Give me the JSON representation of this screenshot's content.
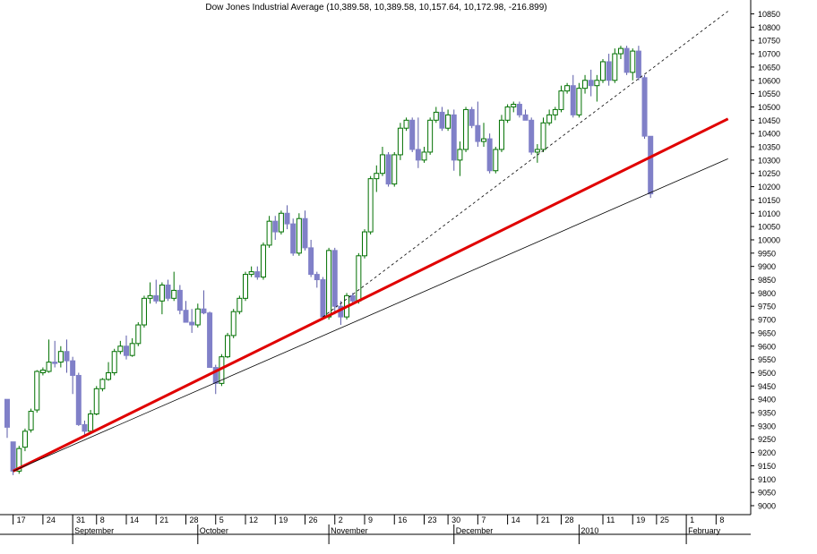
{
  "chart_data": {
    "type": "candlestick",
    "title": "Dow Jones Industrial Average (10,389.58, 10,389.58, 10,157.64, 10,172.98, -216.899)",
    "ylim": [
      8950,
      10900
    ],
    "y_ticks": [
      9000,
      9050,
      9100,
      9150,
      9200,
      9250,
      9300,
      9350,
      9400,
      9450,
      9500,
      9550,
      9600,
      9650,
      9700,
      9750,
      9800,
      9850,
      9900,
      9950,
      10000,
      10050,
      10100,
      10150,
      10200,
      10250,
      10300,
      10350,
      10400,
      10450,
      10500,
      10550,
      10600,
      10650,
      10700,
      10750,
      10800,
      10850
    ],
    "x_day_ticks": [
      {
        "i": 1,
        "label": "17"
      },
      {
        "i": 6,
        "label": "24"
      },
      {
        "i": 11,
        "label": "31"
      },
      {
        "i": 15,
        "label": "8"
      },
      {
        "i": 20,
        "label": "14"
      },
      {
        "i": 25,
        "label": "21"
      },
      {
        "i": 30,
        "label": "28"
      },
      {
        "i": 35,
        "label": "5"
      },
      {
        "i": 40,
        "label": "12"
      },
      {
        "i": 45,
        "label": "19"
      },
      {
        "i": 50,
        "label": "26"
      },
      {
        "i": 55,
        "label": "2"
      },
      {
        "i": 60,
        "label": "9"
      },
      {
        "i": 65,
        "label": "16"
      },
      {
        "i": 70,
        "label": "23"
      },
      {
        "i": 74,
        "label": "30"
      },
      {
        "i": 79,
        "label": "7"
      },
      {
        "i": 84,
        "label": "14"
      },
      {
        "i": 89,
        "label": "21"
      },
      {
        "i": 93,
        "label": "28"
      },
      {
        "i": 100,
        "label": "11"
      },
      {
        "i": 105,
        "label": "19"
      },
      {
        "i": 109,
        "label": "25"
      },
      {
        "i": 114,
        "label": "1"
      },
      {
        "i": 119,
        "label": "8"
      }
    ],
    "x_month_ticks": [
      {
        "i": 11,
        "label": "September"
      },
      {
        "i": 32,
        "label": "October"
      },
      {
        "i": 54,
        "label": "November"
      },
      {
        "i": 75,
        "label": "December"
      },
      {
        "i": 96,
        "label": "2010"
      },
      {
        "i": 114,
        "label": "February"
      }
    ],
    "series": [
      {
        "ohlc": [
          [
            9400,
            9400,
            9255,
            9295
          ],
          [
            9240,
            9240,
            9115,
            9130
          ],
          [
            9130,
            9225,
            9120,
            9215
          ],
          [
            9220,
            9290,
            9205,
            9280
          ],
          [
            9285,
            9365,
            9275,
            9355
          ],
          [
            9360,
            9510,
            9350,
            9505
          ],
          [
            9500,
            9520,
            9490,
            9510
          ],
          [
            9505,
            9625,
            9500,
            9540
          ],
          [
            9540,
            9620,
            9520,
            9535
          ],
          [
            9540,
            9600,
            9520,
            9580
          ],
          [
            9580,
            9625,
            9500,
            9545
          ],
          [
            9545,
            9560,
            9420,
            9490
          ],
          [
            9490,
            9500,
            9300,
            9305
          ],
          [
            9305,
            9320,
            9260,
            9280
          ],
          [
            9280,
            9360,
            9270,
            9345
          ],
          [
            9345,
            9450,
            9340,
            9440
          ],
          [
            9440,
            9480,
            9430,
            9475
          ],
          [
            9475,
            9540,
            9470,
            9500
          ],
          [
            9500,
            9590,
            9490,
            9580
          ],
          [
            9580,
            9620,
            9570,
            9600
          ],
          [
            9600,
            9640,
            9550,
            9565
          ],
          [
            9565,
            9630,
            9560,
            9610
          ],
          [
            9610,
            9690,
            9600,
            9680
          ],
          [
            9680,
            9790,
            9670,
            9780
          ],
          [
            9780,
            9840,
            9760,
            9790
          ],
          [
            9790,
            9850,
            9760,
            9770
          ],
          [
            9770,
            9840,
            9720,
            9830
          ],
          [
            9830,
            9850,
            9770,
            9780
          ],
          [
            9780,
            9880,
            9770,
            9810
          ],
          [
            9810,
            9830,
            9720,
            9735
          ],
          [
            9735,
            9770,
            9690,
            9690
          ],
          [
            9690,
            9740,
            9650,
            9680
          ],
          [
            9680,
            9760,
            9670,
            9740
          ],
          [
            9740,
            9810,
            9720,
            9725
          ],
          [
            9725,
            9730,
            9520,
            9520
          ],
          [
            9520,
            9530,
            9420,
            9460
          ],
          [
            9460,
            9570,
            9450,
            9560
          ],
          [
            9560,
            9650,
            9555,
            9640
          ],
          [
            9640,
            9740,
            9630,
            9730
          ],
          [
            9730,
            9790,
            9720,
            9780
          ],
          [
            9780,
            9880,
            9770,
            9870
          ],
          [
            9870,
            9900,
            9860,
            9880
          ],
          [
            9880,
            9900,
            9850,
            9860
          ],
          [
            9860,
            9990,
            9850,
            9980
          ],
          [
            9980,
            10090,
            9970,
            10070
          ],
          [
            10070,
            10090,
            10000,
            10030
          ],
          [
            10030,
            10110,
            10020,
            10100
          ],
          [
            10100,
            10130,
            10040,
            10060
          ],
          [
            10060,
            10080,
            9940,
            9950
          ],
          [
            9950,
            10100,
            9940,
            10080
          ],
          [
            10080,
            10110,
            9960,
            9970
          ],
          [
            9970,
            10000,
            9860,
            9870
          ],
          [
            9870,
            9880,
            9820,
            9850
          ],
          [
            9850,
            9860,
            9700,
            9710
          ],
          [
            9710,
            9970,
            9700,
            9960
          ],
          [
            9960,
            9970,
            9720,
            9750
          ],
          [
            9750,
            9770,
            9680,
            9710
          ],
          [
            9710,
            9800,
            9700,
            9790
          ],
          [
            9790,
            9800,
            9760,
            9770
          ],
          [
            9770,
            9950,
            9760,
            9940
          ],
          [
            9940,
            10040,
            9930,
            10030
          ],
          [
            10030,
            10240,
            10020,
            10230
          ],
          [
            10230,
            10280,
            10180,
            10250
          ],
          [
            10250,
            10350,
            10240,
            10320
          ],
          [
            10320,
            10330,
            10200,
            10210
          ],
          [
            10210,
            10330,
            10200,
            10320
          ],
          [
            10320,
            10440,
            10300,
            10420
          ],
          [
            10420,
            10460,
            10410,
            10450
          ],
          [
            10450,
            10460,
            10330,
            10340
          ],
          [
            10340,
            10460,
            10270,
            10300
          ],
          [
            10300,
            10350,
            10290,
            10330
          ],
          [
            10330,
            10460,
            10320,
            10450
          ],
          [
            10450,
            10500,
            10440,
            10480
          ],
          [
            10480,
            10500,
            10410,
            10420
          ],
          [
            10420,
            10490,
            10410,
            10470
          ],
          [
            10470,
            10490,
            10260,
            10300
          ],
          [
            10300,
            10370,
            10240,
            10340
          ],
          [
            10340,
            10500,
            10330,
            10490
          ],
          [
            10490,
            10500,
            10420,
            10430
          ],
          [
            10430,
            10520,
            10350,
            10370
          ],
          [
            10370,
            10440,
            10350,
            10380
          ],
          [
            10380,
            10400,
            10250,
            10260
          ],
          [
            10260,
            10350,
            10250,
            10340
          ],
          [
            10340,
            10470,
            10330,
            10450
          ],
          [
            10450,
            10510,
            10440,
            10500
          ],
          [
            10500,
            10520,
            10480,
            10510
          ],
          [
            10510,
            10520,
            10460,
            10470
          ],
          [
            10470,
            10490,
            10450,
            10450
          ],
          [
            10450,
            10460,
            10320,
            10330
          ],
          [
            10330,
            10360,
            10290,
            10340
          ],
          [
            10340,
            10460,
            10330,
            10440
          ],
          [
            10440,
            10490,
            10430,
            10470
          ],
          [
            10470,
            10500,
            10450,
            10490
          ],
          [
            10490,
            10580,
            10480,
            10560
          ],
          [
            10560,
            10590,
            10550,
            10580
          ],
          [
            10580,
            10620,
            10460,
            10470
          ],
          [
            10470,
            10590,
            10460,
            10570
          ],
          [
            10570,
            10620,
            10550,
            10600
          ],
          [
            10600,
            10640,
            10540,
            10580
          ],
          [
            10580,
            10620,
            10520,
            10600
          ],
          [
            10600,
            10680,
            10590,
            10670
          ],
          [
            10670,
            10700,
            10580,
            10600
          ],
          [
            10600,
            10720,
            10590,
            10700
          ],
          [
            10700,
            10730,
            10680,
            10720
          ],
          [
            10720,
            10730,
            10620,
            10630
          ],
          [
            10630,
            10720,
            10600,
            10710
          ],
          [
            10710,
            10730,
            10600,
            10610
          ],
          [
            10610,
            10620,
            10380,
            10390
          ],
          [
            10389.58,
            10389.58,
            10157.64,
            10172.98
          ]
        ]
      }
    ],
    "annotations": [
      {
        "type": "trendline",
        "color": "#e00000",
        "style": "solid",
        "from": [
          1,
          9130
        ],
        "to": [
          121,
          10455
        ]
      },
      {
        "type": "trendline",
        "color": "#000000",
        "style": "solid",
        "from": [
          1,
          9130
        ],
        "to": [
          121,
          10305
        ]
      },
      {
        "type": "trendline",
        "color": "#000000",
        "style": "dashed",
        "from": [
          53,
          9710
        ],
        "to": [
          121,
          10860
        ]
      }
    ],
    "colors": {
      "up": "#007000",
      "down": "#8080c8",
      "frame": "#000000"
    }
  }
}
